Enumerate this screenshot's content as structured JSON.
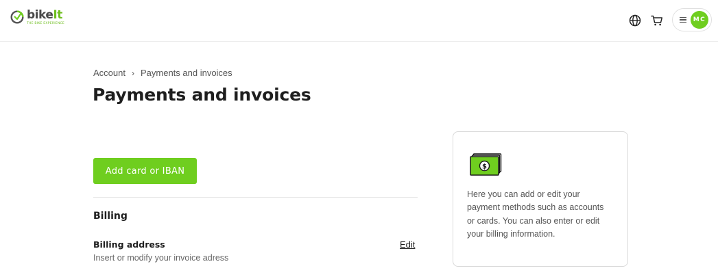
{
  "brand": {
    "logo_word_prefix": "b",
    "logo_word_rest": "ike",
    "logo_word_suffix": "It",
    "tagline": "THE BIKE EXPERIENCE",
    "accent_color": "#6fce1f"
  },
  "header": {
    "icons": [
      "globe-icon",
      "cart-icon",
      "menu-icon"
    ],
    "avatar_initials": "MC"
  },
  "breadcrumb": {
    "items": [
      "Account",
      "Payments and invoices"
    ],
    "separator": "›"
  },
  "page": {
    "title": "Payments and invoices"
  },
  "actions": {
    "add_card_label": "Add card or IBAN"
  },
  "billing": {
    "section_title": "Billing",
    "address_label": "Billing address",
    "address_description": "Insert or modify your invoice adress",
    "edit_label": "Edit"
  },
  "info_card": {
    "icon": "money-icon",
    "text": "Here you can add or edit your payment methods such as accounts or cards. You can also enter or edit your billing information."
  }
}
